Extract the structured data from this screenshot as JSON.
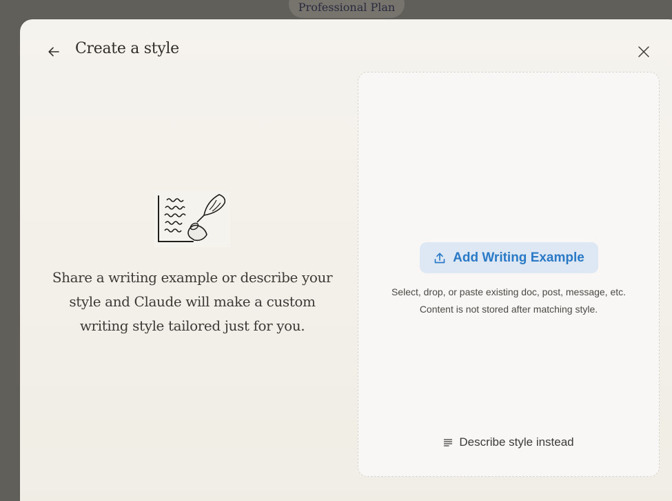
{
  "background": {
    "plan_badge": "Professional Plan"
  },
  "modal": {
    "title": "Create a style",
    "back_icon": "arrow-left-icon",
    "close_icon": "close-icon",
    "intro_text": "Share a writing example or describe your style and Claude will make a custom writing style tailored just for you.",
    "illustration": "writing-quill-illustration"
  },
  "upload": {
    "button_label": "Add Writing Example",
    "button_icon": "upload-icon",
    "helper_line1": "Select, drop, or paste existing doc, post, message, etc.",
    "helper_line2": "Content is not stored after matching style."
  },
  "describe": {
    "label": "Describe style instead",
    "icon": "text-lines-icon"
  },
  "colors": {
    "accent": "#2a79c6",
    "accent_bg": "#dde8f4",
    "overlay": "#605f5a",
    "modal_bg": "#f5f3ed"
  }
}
